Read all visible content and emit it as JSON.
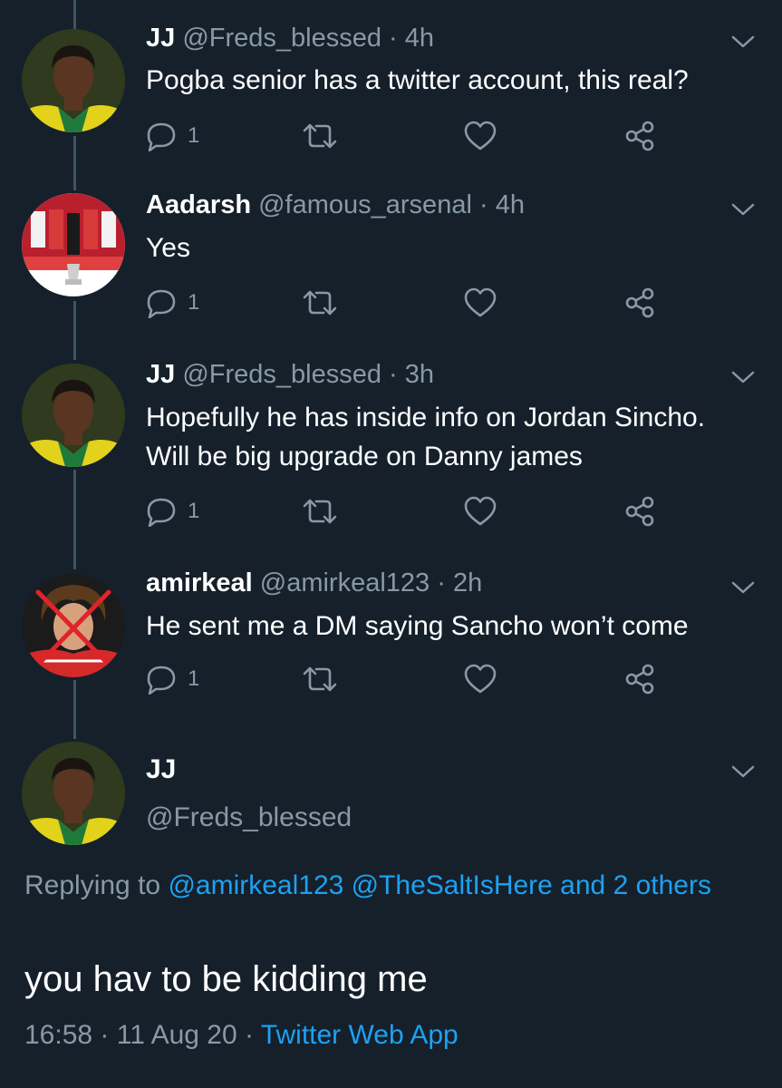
{
  "tweets": [
    {
      "name": "JJ",
      "handle": "@Freds_blessed",
      "time": "4h",
      "text": "Pogba senior has a twitter account, this real?",
      "reply_count": "1",
      "avatar": "player-yellow-jersey"
    },
    {
      "name": "Aadarsh",
      "handle": "@famous_arsenal",
      "time": "4h",
      "text": "Yes",
      "reply_count": "1",
      "avatar": "team-trophy-photo"
    },
    {
      "name": "JJ",
      "handle": "@Freds_blessed",
      "time": "3h",
      "text": "Hopefully he has inside info on Jordan Sincho. Will be big upgrade on Danny james",
      "reply_count": "1",
      "avatar": "player-yellow-jersey"
    },
    {
      "name": "amirkeal",
      "handle": "@amirkeal123",
      "time": "2h",
      "text": "He sent me a DM saying Sancho won’t come",
      "reply_count": "1",
      "avatar": "player-crossed-out"
    }
  ],
  "main_tweet": {
    "name": "JJ",
    "handle": "@Freds_blessed",
    "replying_prefix": "Replying to",
    "replying_to": "@amirkeal123 @TheSaltIsHere and 2 others",
    "text": "you hav to be kidding me",
    "time": "16:58",
    "date": "11 Aug 20",
    "source": "Twitter Web App"
  },
  "separator": "·",
  "icons": [
    "reply-icon",
    "retweet-icon",
    "like-icon",
    "share-icon",
    "chevron-down-icon"
  ],
  "colors": {
    "background": "#15202b",
    "secondary_text": "#8899a6",
    "link": "#1da1f2",
    "thread_line": "#3d5466",
    "primary_text": "#ffffff"
  }
}
